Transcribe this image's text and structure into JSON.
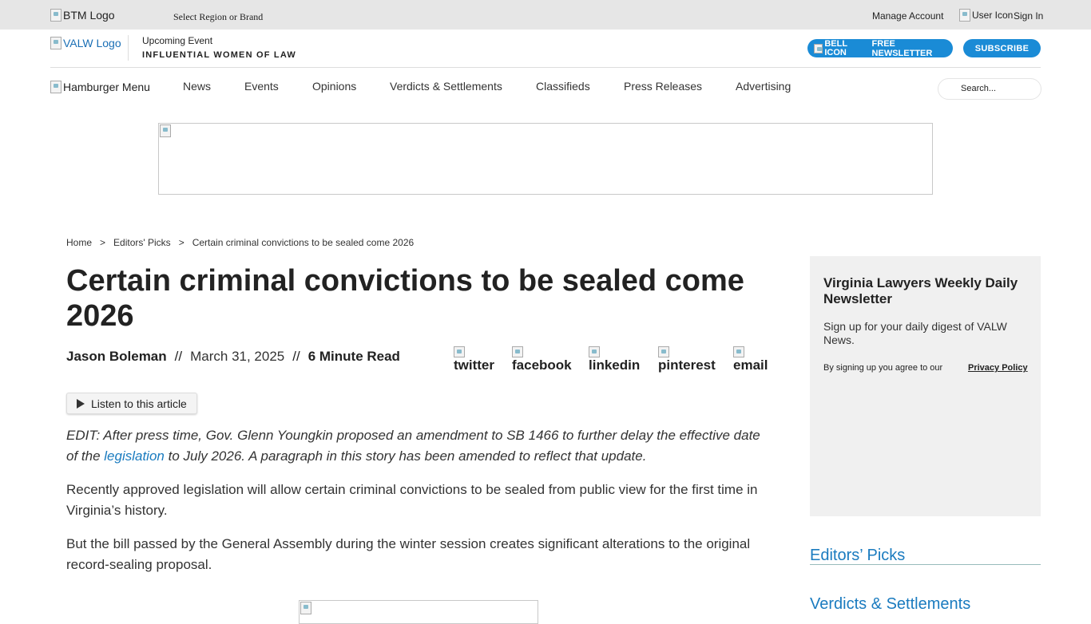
{
  "topbar": {
    "logo_alt": "BTM Logo",
    "region_label": "Select Region or Brand",
    "manage_account": "Manage Account",
    "user_icon_alt": "User Icon",
    "sign_in": "Sign In"
  },
  "header": {
    "brand_logo_alt": "VALW Logo",
    "upcoming_label": "Upcoming Event",
    "event_name": "INFLUENTIAL WOMEN OF LAW",
    "newsletter_button": {
      "icon_alt": "BELL ICON",
      "label": "FREE NEWSLETTER"
    },
    "subscribe_button": "SUBSCRIBE"
  },
  "nav": {
    "hamburger_alt": "Hamburger Menu",
    "items": [
      "News",
      "Events",
      "Opinions",
      "Verdicts & Settlements",
      "Classifieds",
      "Press Releases",
      "Advertising"
    ],
    "search_placeholder": "Search..."
  },
  "breadcrumb": {
    "items": [
      "Home",
      "Editors' Picks",
      "Certain criminal convictions to be sealed come 2026"
    ],
    "separator": ">"
  },
  "article": {
    "title": "Certain criminal convictions to be sealed come 2026",
    "author": "Jason Boleman",
    "divider": "//",
    "date": "March 31, 2025",
    "read_time": "6 Minute Read",
    "share": [
      "twitter",
      "facebook",
      "linkedin",
      "pinterest",
      "email"
    ],
    "listen_label": "Listen to this article",
    "edit_note_before": "EDIT: After press time, Gov. Glenn Youngkin proposed an amendment to SB 1466 to further delay the effective date of the ",
    "edit_note_link": "legislation",
    "edit_note_after": " to July 2026. A paragraph in this story has been amended to reflect that update.",
    "paragraphs": [
      "Recently approved legislation will allow certain criminal convictions to be sealed from public view for the first time in Virginia’s history.",
      "But the bill passed by the General Assembly during the winter session creates significant alterations to the original record-sealing proposal."
    ]
  },
  "sidebar": {
    "newsletter_title": "Virginia Lawyers Weekly Daily Newsletter",
    "newsletter_sub": "Sign up for your daily digest of VALW News.",
    "agree_text": "By signing up you agree to our",
    "privacy_link": "Privacy Policy",
    "sections": [
      "Editors’ Picks",
      "Verdicts & Settlements"
    ]
  },
  "colors": {
    "accent": "#1a8bd6",
    "link": "#1a7bbf",
    "topbar_bg": "#e6e6e6",
    "sidebar_bg": "#f0f0f0"
  }
}
